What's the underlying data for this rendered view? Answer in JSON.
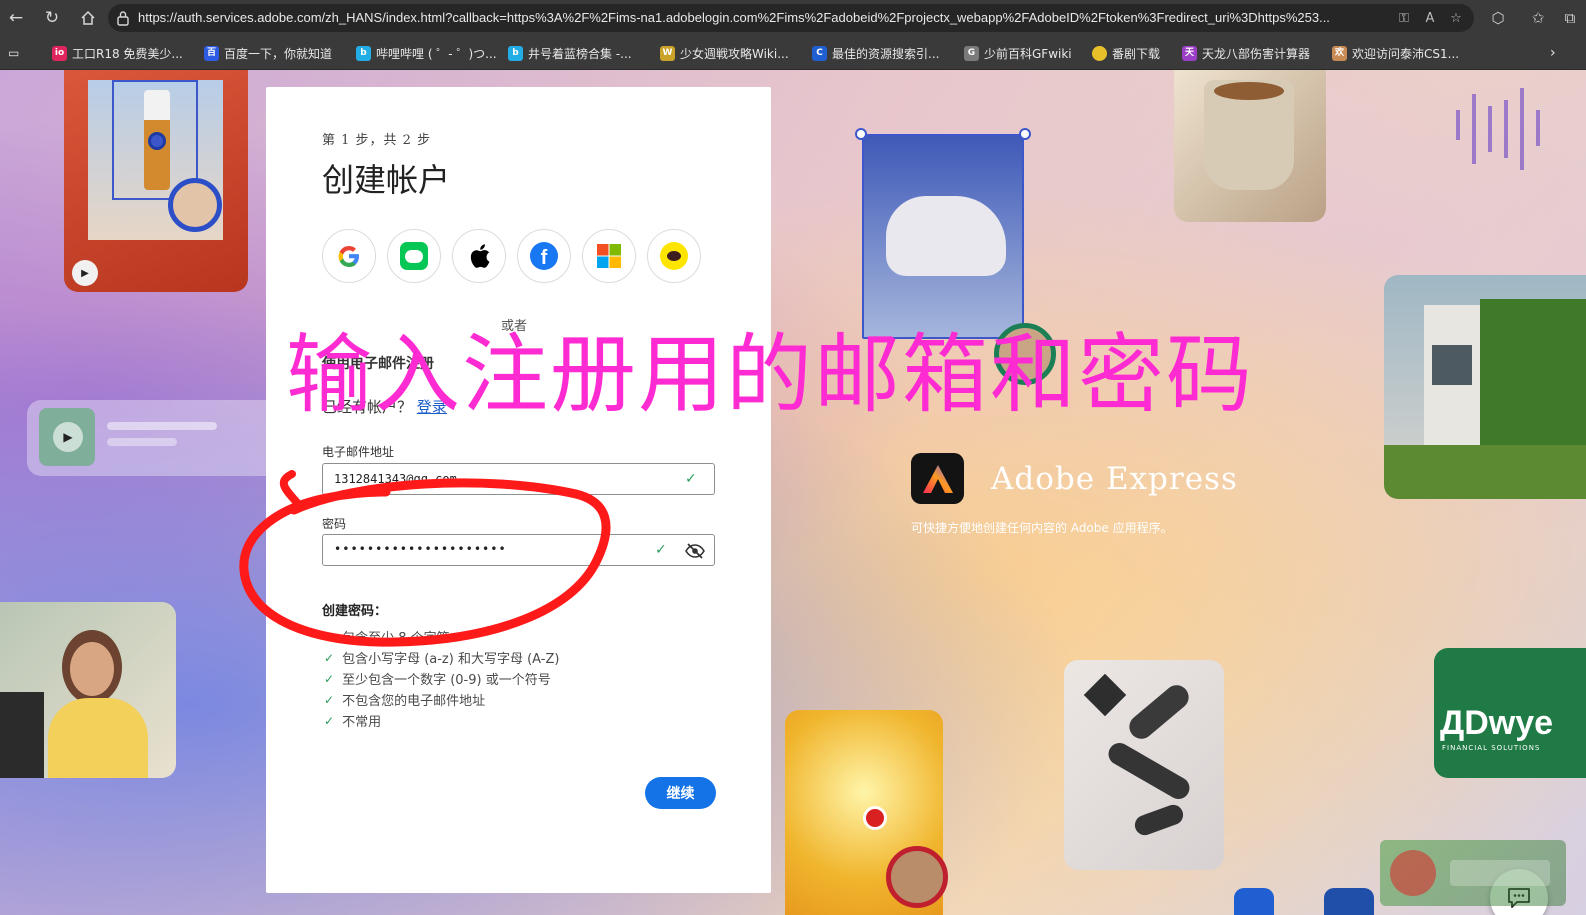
{
  "browser": {
    "url": "https://auth.services.adobe.com/zh_HANS/index.html?callback=https%3A%2F%2Fims-na1.adobelogin.com%2Fims%2Fadobeid%2Fprojectx_webapp%2FAdobeID%2Ftoken%3Fredirect_uri%3Dhttps%253..."
  },
  "bookmarks": [
    {
      "label": "工口R18 免费美少...",
      "icon_color": "#e0245e",
      "icon_text": "io"
    },
    {
      "label": "百度一下，你就知道",
      "icon_color": "#2d5be3",
      "icon_text": "百"
    },
    {
      "label": "哔哩哔哩 ( ゜- ゜)つ...",
      "icon_color": "#23ade5",
      "icon_text": "b"
    },
    {
      "label": "井号着蓝榜合集 -...",
      "icon_color": "#23ade5",
      "icon_text": "b"
    },
    {
      "label": "少女週戦攻略Wiki...",
      "icon_color": "#c9a227",
      "icon_text": "W"
    },
    {
      "label": "最佳的资源搜索引...",
      "icon_color": "#1f5fd1",
      "icon_text": "C"
    },
    {
      "label": "少前百科GFwiki",
      "icon_color": "#7a7a7a",
      "icon_text": "G"
    },
    {
      "label": "番剧下载",
      "icon_color": "#e8c12a",
      "icon_text": "●"
    },
    {
      "label": "天龙八部伤害计算器",
      "icon_color": "#9b3fc6",
      "icon_text": "天"
    },
    {
      "label": "欢迎访问泰沛CS1...",
      "icon_color": "#c98b55",
      "icon_text": "欢"
    }
  ],
  "signup": {
    "step": "第 1 步，共 2 步",
    "title": "创建帐户",
    "or": "或者",
    "email_signup": "使用电子邮件注册",
    "have_account": "已经有帐户？",
    "login": "登录",
    "email_label": "电子邮件地址",
    "email_value": "1312841343@qq.com",
    "password_label": "密码",
    "password_value": "•••••••••••••••••••••",
    "pw_title": "创建密码：",
    "requirements": [
      "包含至少 8 个字符",
      "包含小写字母 (a-z) 和大写字母 (A-Z)",
      "至少包含一个数字 (0-9) 或一个符号",
      "不包含您的电子邮件地址",
      "不常用"
    ],
    "continue": "继续"
  },
  "product": {
    "name": "Adobe Express",
    "description": "可快捷方便地创建任何内容的 Adobe 应用程序。"
  },
  "overlay_text": "输入注册用的邮箱和密码",
  "tile_labels": {
    "dwyer": "ДDwye",
    "dwyer_sub": "FINANCIAL SOLUTIONS"
  },
  "colors": {
    "accent": "#1473e6",
    "overlay": "#ff2bd2",
    "success": "#2d9d5f",
    "annotation": "#ff1a1a"
  }
}
